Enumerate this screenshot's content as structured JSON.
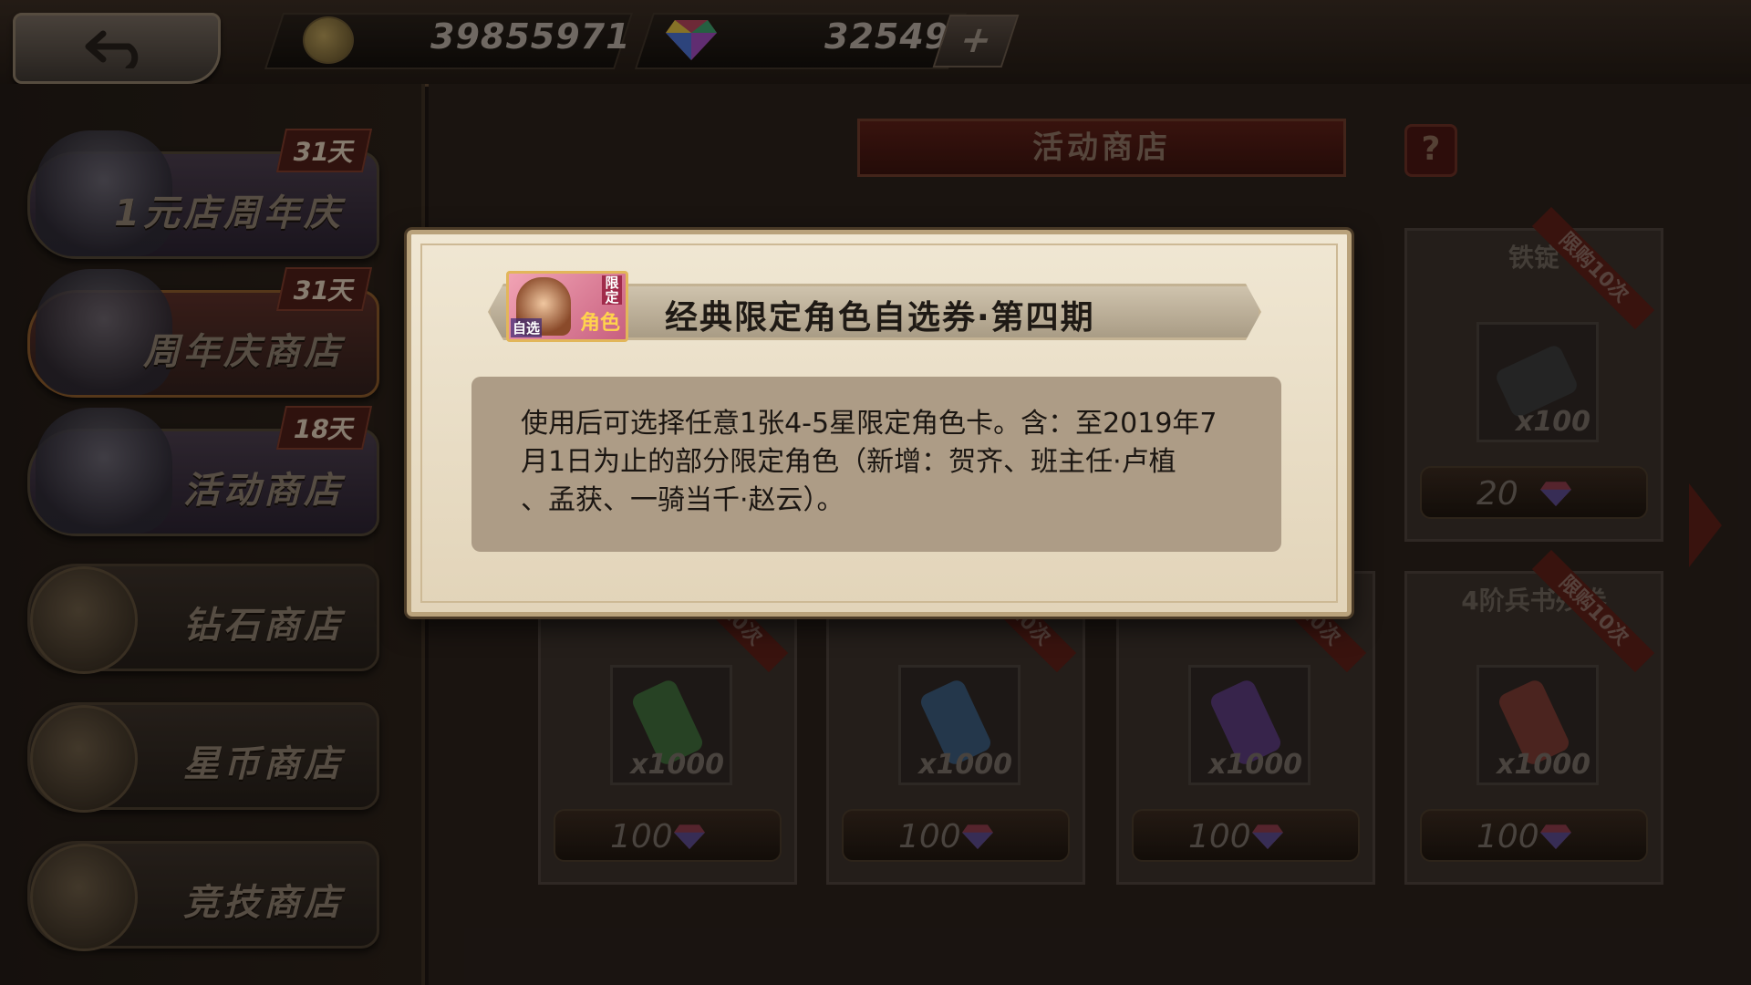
{
  "topbar": {
    "coins": "39855971",
    "gems": "32549",
    "plus_label": "+"
  },
  "sidebar": {
    "items": [
      {
        "label": "1元店周年庆",
        "days": "31天"
      },
      {
        "label": "周年庆商店",
        "days": "31天"
      },
      {
        "label": "活动商店",
        "days": "18天"
      },
      {
        "label": "钻石商店"
      },
      {
        "label": "星币商店"
      },
      {
        "label": "竞技商店"
      }
    ]
  },
  "shop": {
    "title": "活动商店",
    "help_label": "?",
    "cards": [
      {
        "name": "铁锭",
        "limit": "限购10次",
        "qty": "x100",
        "price": "20",
        "color": "#3a3a3a"
      },
      {
        "name": "",
        "limit": "限购10次",
        "qty": "x1000",
        "price": "100",
        "color": "#3f6b3a"
      },
      {
        "name": "",
        "limit": "限购10次",
        "qty": "x1000",
        "price": "100",
        "color": "#3a5a7a"
      },
      {
        "name": "",
        "limit": "限购10次",
        "qty": "x1000",
        "price": "100",
        "color": "#5a3a7a"
      },
      {
        "name": "4阶兵书残卷",
        "limit": "限购10次",
        "qty": "x1000",
        "price": "100",
        "color": "#7a3a32"
      }
    ]
  },
  "dialog": {
    "title": "经典限定角色自选券·第四期",
    "icon_tags": {
      "limited": "限定",
      "select": "自选",
      "role": "角色"
    },
    "description_lines": [
      "使用后可选择任意1张4-5星限定角色卡。含：至2019年7",
      "月1日为止的部分限定角色（新增：贺齐、班主任·卢植",
      "、孟获、一骑当千·赵云）。"
    ]
  }
}
